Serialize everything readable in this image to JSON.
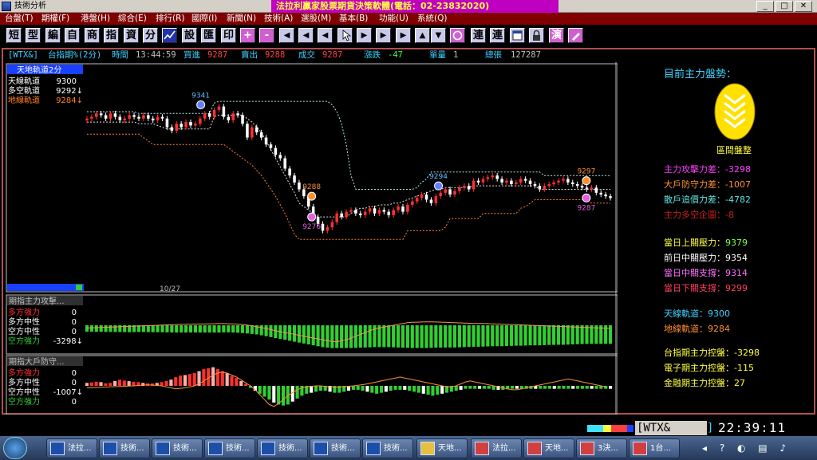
{
  "window": {
    "title": "技術分析",
    "marquee": "法拉利贏家股票期貨決策軟體(電話：02-23832020)",
    "buttons": [
      "_",
      "□",
      "✕"
    ]
  },
  "menu": [
    "台盤(T)",
    "期權(F)",
    "港盤(H)",
    "綜合(E)",
    "排行(R)",
    "國際(I)",
    "新聞(N)",
    "技術(A)",
    "選股(M)",
    "基本(B)",
    "功能(U)",
    "系統(Q)"
  ],
  "toolbar": {
    "chars": [
      "短",
      "型",
      "編",
      "自",
      "商",
      "指",
      "資",
      "分",
      "",
      "設",
      "匯",
      "印",
      "+",
      "-",
      "◀",
      "◀",
      "◀",
      "",
      "▶",
      "▶",
      "▶",
      "▲",
      "▼",
      "",
      "連",
      "連",
      "",
      "",
      "演",
      ""
    ]
  },
  "quote": {
    "symbol": "[WTX&]",
    "name": "台指期%(2分)",
    "time_label": "時間",
    "time": "13:44:59",
    "buy_label": "買進",
    "buy": "9287",
    "sell_label": "賣出",
    "sell": "9288",
    "deal_label": "成交",
    "deal": "9287",
    "change_label": "漲跌",
    "change": "-47",
    "vol_label": "單量",
    "vol": "1",
    "total_label": "總張",
    "total": "127287"
  },
  "colors": {
    "up": "#ff3030",
    "down": "#ffffff",
    "green": "#30d030",
    "pink": "#ff70ff",
    "orange": "#ff9030",
    "cyan": "#60e0e0",
    "frame": "#b05050"
  },
  "main_legend": {
    "title": "天地軌道2分",
    "rows": [
      {
        "label": "天線軌道",
        "value": "9300",
        "color": "#ffffff"
      },
      {
        "label": "多空軌道",
        "value": "9292↓",
        "color": "#ffffff"
      },
      {
        "label": "地線軌道",
        "value": "9284↓",
        "color": "#ff7f27"
      }
    ]
  },
  "sub1_legend": {
    "title": "期指主力攻擊...",
    "rows": [
      {
        "label": "多方強力",
        "value": "0",
        "color": "#ff3030"
      },
      {
        "label": "多方中性",
        "value": "0",
        "color": "#ffffff"
      },
      {
        "label": "空方中性",
        "value": "0",
        "color": "#ffffff"
      },
      {
        "label": "空方強力",
        "value": "-3298↓",
        "color": "#30d030"
      }
    ]
  },
  "sub2_legend": {
    "title": "期指大戶防守...",
    "rows": [
      {
        "label": "多方強力",
        "value": "0",
        "color": "#ff3030"
      },
      {
        "label": "多方中性",
        "value": "0",
        "color": "#ffffff"
      },
      {
        "label": "空方中性",
        "value": "-1007↓",
        "color": "#ffffff"
      },
      {
        "label": "空方強力",
        "value": "0",
        "color": "#30d030"
      }
    ]
  },
  "chart_data": {
    "type": "candlestick",
    "main_axis": {
      "ticks": [
        "9353.75",
        "9340.63",
        "9327.51",
        "9314.38",
        "9301.26",
        "9288.14",
        "9275.02",
        "9261.89",
        "9248.77"
      ],
      "ylim": [
        9240,
        9362
      ]
    },
    "date_label": "10/27",
    "markers": [
      {
        "label": "9341",
        "x": 0.22,
        "y": 9341,
        "kind": "blue"
      },
      {
        "label": "9288",
        "x": 0.43,
        "y": 9288,
        "kind": "orange"
      },
      {
        "label": "9276",
        "x": 0.43,
        "y": 9276,
        "kind": "pink"
      },
      {
        "label": "9294",
        "x": 0.67,
        "y": 9294,
        "kind": "blue"
      },
      {
        "label": "9297",
        "x": 0.95,
        "y": 9297,
        "kind": "orange"
      },
      {
        "label": "9287",
        "x": 0.95,
        "y": 9287,
        "kind": "pink"
      }
    ],
    "close": [
      9333,
      9334,
      9336,
      9335,
      9333,
      9336,
      9334,
      9332,
      9333,
      9335,
      9334,
      9333,
      9335,
      9333,
      9332,
      9334,
      9333,
      9328,
      9326,
      9330,
      9328,
      9331,
      9329,
      9330,
      9333,
      9336,
      9334,
      9338,
      9340,
      9334,
      9332,
      9336,
      9335,
      9330,
      9322,
      9328,
      9325,
      9322,
      9318,
      9316,
      9312,
      9310,
      9304,
      9300,
      9296,
      9292,
      9288,
      9282,
      9276,
      9272,
      9268,
      9270,
      9273,
      9278,
      9276,
      9279,
      9280,
      9278,
      9277,
      9279,
      9281,
      9278,
      9280,
      9279,
      9277,
      9280,
      9282,
      9279,
      9283,
      9285,
      9287,
      9289,
      9286,
      9284,
      9288,
      9290,
      9292,
      9289,
      9291,
      9293,
      9294,
      9292,
      9297,
      9296,
      9298,
      9299,
      9300,
      9298,
      9296,
      9297,
      9295,
      9296,
      9298,
      9297,
      9295,
      9294,
      9292,
      9294,
      9295,
      9296,
      9297,
      9298,
      9296,
      9295,
      9294,
      9293,
      9292,
      9293,
      9290,
      9289,
      9288,
      9287
    ],
    "upper_band": [
      9337,
      9337,
      9337,
      9337,
      9337,
      9337,
      9337,
      9337,
      9337,
      9337,
      9337,
      9336,
      9336,
      9336,
      9336,
      9336,
      9336,
      9336,
      9336,
      9336,
      9336,
      9336,
      9336,
      9336,
      9336,
      9336,
      9336,
      9342,
      9343,
      9343,
      9343,
      9343,
      9343,
      9343,
      9343,
      9343,
      9343,
      9343,
      9343,
      9343,
      9343,
      9343,
      9343,
      9343,
      9343,
      9343,
      9343,
      9343,
      9343,
      9343,
      9343,
      9343,
      9341,
      9337,
      9330,
      9318,
      9300,
      9292,
      9292,
      9292,
      9292,
      9292,
      9292,
      9292,
      9292,
      9292,
      9292,
      9292,
      9292,
      9292,
      9293,
      9296,
      9298,
      9302,
      9302,
      9302,
      9302,
      9302,
      9302,
      9302,
      9302,
      9302,
      9302,
      9302,
      9302,
      9302,
      9302,
      9302,
      9302,
      9302,
      9302,
      9302,
      9302,
      9302,
      9302,
      9302,
      9302,
      9300,
      9300,
      9300,
      9300,
      9300,
      9300,
      9300,
      9300,
      9300,
      9300,
      9300,
      9300,
      9300,
      9300,
      9300
    ],
    "mid_band": [
      9331,
      9331,
      9331,
      9331,
      9331,
      9331,
      9331,
      9331,
      9331,
      9331,
      9331,
      9330,
      9330,
      9330,
      9330,
      9329,
      9328,
      9327,
      9327,
      9327,
      9327,
      9327,
      9327,
      9327,
      9327,
      9327,
      9327,
      9334,
      9335,
      9335,
      9335,
      9335,
      9335,
      9335,
      9333,
      9331,
      9328,
      9325,
      9320,
      9315,
      9310,
      9305,
      9300,
      9295,
      9290,
      9284,
      9282,
      9280,
      9278,
      9276,
      9276,
      9276,
      9276,
      9276,
      9276,
      9276,
      9278,
      9280,
      9281,
      9281,
      9282,
      9282,
      9283,
      9283,
      9283,
      9284,
      9284,
      9285,
      9286,
      9287,
      9288,
      9289,
      9290,
      9291,
      9292,
      9292,
      9293,
      9293,
      9293,
      9293,
      9293,
      9293,
      9294,
      9294,
      9294,
      9294,
      9294,
      9294,
      9294,
      9294,
      9294,
      9294,
      9294,
      9294,
      9294,
      9294,
      9292,
      9292,
      9292,
      9292,
      9292,
      9292,
      9292,
      9292,
      9292,
      9292,
      9292,
      9292,
      9292,
      9292,
      9292,
      9292
    ],
    "lower_band": [
      9324,
      9324,
      9324,
      9324,
      9324,
      9324,
      9324,
      9324,
      9324,
      9324,
      9324,
      9324,
      9322,
      9320,
      9318,
      9318,
      9318,
      9318,
      9318,
      9318,
      9318,
      9318,
      9318,
      9318,
      9318,
      9318,
      9318,
      9318,
      9318,
      9318,
      9316,
      9314,
      9312,
      9310,
      9308,
      9306,
      9303,
      9300,
      9296,
      9292,
      9288,
      9283,
      9278,
      9272,
      9266,
      9263,
      9263,
      9263,
      9263,
      9263,
      9263,
      9263,
      9263,
      9263,
      9263,
      9263,
      9263,
      9263,
      9263,
      9263,
      9263,
      9263,
      9263,
      9263,
      9263,
      9263,
      9263,
      9263,
      9268,
      9268,
      9268,
      9268,
      9268,
      9268,
      9268,
      9268,
      9270,
      9275,
      9275,
      9275,
      9275,
      9275,
      9275,
      9275,
      9278,
      9278,
      9278,
      9278,
      9278,
      9278,
      9278,
      9278,
      9281,
      9282,
      9284,
      9286,
      9286,
      9286,
      9286,
      9286,
      9286,
      9286,
      9286,
      9286,
      9286,
      9286,
      9286,
      9284,
      9284,
      9284,
      9284,
      9284
    ],
    "sub1_axis": {
      "ticks": [
        "2511.15",
        "0.00",
        "-2511.15"
      ],
      "ylim": [
        -2800,
        2800
      ]
    },
    "sub1_bars": [
      -700,
      -700,
      -720,
      -720,
      -730,
      -730,
      -740,
      -740,
      -750,
      -760,
      -750,
      -740,
      -740,
      -750,
      -760,
      -760,
      -770,
      -780,
      -790,
      -800,
      -800,
      -800,
      -790,
      -790,
      -800,
      -800,
      -800,
      -800,
      -800,
      -780,
      -780,
      -800,
      -820,
      -850,
      -900,
      -950,
      -1000,
      -1100,
      -1200,
      -1300,
      -1400,
      -1500,
      -1600,
      -1700,
      -1800,
      -1900,
      -2000,
      -2100,
      -2200,
      -2300,
      -2400,
      -2450,
      -2500,
      -2500,
      -2500,
      -2500,
      -2500,
      -2480,
      -2460,
      -2440,
      -2420,
      -2400,
      -2400,
      -2400,
      -2400,
      -2420,
      -2440,
      -2460,
      -2480,
      -2500,
      -2500,
      -2500,
      -2500,
      -2480,
      -2460,
      -2450,
      -2440,
      -2440,
      -2440,
      -2420,
      -2400,
      -2380,
      -2360,
      -2360,
      -2340,
      -2320,
      -2300,
      -2300,
      -2300,
      -2280,
      -2260,
      -2240,
      -2240,
      -2220,
      -2200,
      -2200,
      -2200,
      -2180,
      -2160,
      -2150,
      -2140,
      -2140,
      -2120,
      -2100,
      -2080,
      -2060,
      -2050,
      -2040,
      -2040,
      -2040,
      -2040,
      -2040
    ],
    "sub1_line": [
      -300,
      -280,
      -260,
      -240,
      -220,
      -200,
      -180,
      -160,
      -140,
      -120,
      -100,
      -80,
      -60,
      -40,
      -20,
      0,
      20,
      40,
      60,
      80,
      100,
      110,
      120,
      130,
      140,
      150,
      160,
      170,
      180,
      180,
      170,
      150,
      120,
      80,
      20,
      -60,
      -150,
      -250,
      -360,
      -480,
      -600,
      -700,
      -800,
      -900,
      -1000,
      -1100,
      -1200,
      -1300,
      -1400,
      -1500,
      -1600,
      -1700,
      -1780,
      -1800,
      -1700,
      -1600,
      -1400,
      -1200,
      -1000,
      -800,
      -600,
      -400,
      -300,
      -200,
      -100,
      0,
      100,
      200,
      280,
      320,
      340,
      360,
      380,
      380,
      360,
      340,
      320,
      300,
      280,
      260,
      240,
      220,
      200,
      200,
      200,
      180,
      160,
      140,
      120,
      100,
      80,
      60,
      40,
      20,
      0,
      -20,
      -40,
      -60,
      -80,
      -100,
      -120,
      -140,
      -160,
      -180,
      -200,
      -220,
      -240,
      -260,
      -280,
      -300,
      -320,
      -340
    ],
    "sub2_axis": {
      "ticks": [
        "2346.18",
        "0.00",
        "-2346.18"
      ],
      "ylim": [
        -2600,
        2600
      ]
    },
    "sub2_bars": [
      300,
      350,
      420,
      380,
      260,
      300,
      500,
      620,
      540,
      480,
      420,
      380,
      300,
      260,
      240,
      300,
      380,
      500,
      640,
      880,
      1050,
      1100,
      1200,
      1300,
      1500,
      1700,
      1800,
      1900,
      1700,
      1500,
      1300,
      1000,
      800,
      500,
      200,
      -200,
      -500,
      -800,
      -1100,
      -1400,
      -1700,
      -1900,
      -2000,
      -1900,
      -1600,
      -1300,
      -1000,
      -800,
      -700,
      -600,
      -500,
      -500,
      -600,
      -700,
      -700,
      -600,
      -500,
      -400,
      -400,
      -500,
      -600,
      -700,
      -800,
      -700,
      -600,
      -500,
      -400,
      -400,
      -400,
      -500,
      -600,
      -700,
      -800,
      -900,
      -1000,
      -900,
      -800,
      -700,
      -600,
      -500,
      -400,
      -300,
      -300,
      -300,
      -300,
      -300,
      -300,
      -400,
      -400,
      -400,
      -350,
      -300,
      -300,
      -300,
      -300,
      -300,
      -300,
      -300,
      -300,
      -300,
      -300,
      -300,
      -300,
      -300,
      -300,
      -300,
      -300,
      -300,
      -300,
      -300,
      -300,
      -300,
      -300
    ],
    "sub2_line": [
      -200,
      -180,
      -160,
      -140,
      -120,
      -100,
      -80,
      -60,
      -40,
      -20,
      0,
      40,
      80,
      100,
      80,
      40,
      0,
      -100,
      -200,
      -300,
      -250,
      -200,
      -100,
      0,
      200,
      500,
      800,
      1100,
      1300,
      1400,
      1300,
      1100,
      900,
      600,
      300,
      0,
      -400,
      -900,
      -1400,
      -1900,
      -2100,
      -1800,
      -1400,
      -1000,
      -700,
      -400,
      -200,
      -100,
      -50,
      0,
      0,
      -50,
      -100,
      -150,
      -120,
      -80,
      -40,
      0,
      60,
      120,
      200,
      300,
      400,
      500,
      600,
      700,
      800,
      900,
      800,
      700,
      600,
      500,
      400,
      300,
      200,
      100,
      0,
      -100,
      -100,
      0,
      200,
      400,
      500,
      400,
      300,
      200,
      100,
      0,
      -100,
      -200,
      -300,
      -400,
      -400,
      -300,
      -200,
      -100,
      0,
      100,
      200,
      300,
      400,
      500,
      600,
      700,
      600,
      500,
      400,
      300,
      200,
      100,
      0,
      -100
    ]
  },
  "side": {
    "title": "目前主力盤勢：",
    "badge_text": "區間盤整",
    "strengths": [
      {
        "label": "主力攻擊力差：",
        "value": "-3298",
        "color": "#ff40ff"
      },
      {
        "label": "大戶防守力差：",
        "value": "-1007",
        "color": "#ff9030"
      },
      {
        "label": "散戶追價力差：",
        "value": "-4782",
        "color": "#60e0e0"
      },
      {
        "label": "主力多空企圖：",
        "value": "-8",
        "color": "#cc2020"
      }
    ],
    "pressures": [
      {
        "label": "當日上關壓力：",
        "value": "9379",
        "color": "#80ff40"
      },
      {
        "label": "前日中關壓力：",
        "value": "9354",
        "color": "#ffffff"
      },
      {
        "label": "當日中關支撐：",
        "value": "9314",
        "color": "#ff70ff"
      },
      {
        "label": "當日下關支撐：",
        "value": "9299",
        "color": "#ff4060"
      }
    ],
    "tracks": [
      {
        "label": "天線軌道：",
        "value": "9300",
        "color": "#ffffff"
      },
      {
        "label": "地線軌道：",
        "value": "9284",
        "color": "#ff9030"
      }
    ],
    "controls": [
      {
        "label": "台指期主力控盤：",
        "value": "-3298",
        "color": "#ffff40"
      },
      {
        "label": "電子期主力控盤：",
        "value": "-115",
        "color": "#ffff40"
      },
      {
        "label": "金融期主力控盤：",
        "value": "27",
        "color": "#ffff40"
      }
    ]
  },
  "status": {
    "code": "[WTX&",
    "bracket": "]",
    "clock": "22:39:11"
  },
  "taskbar": {
    "items": [
      "法拉...",
      "技術...",
      "技術...",
      "技術...",
      "技術...",
      "技術...",
      "技術...",
      "天地...",
      "法拉...",
      "天地...",
      "3決...",
      "1台..."
    ]
  }
}
